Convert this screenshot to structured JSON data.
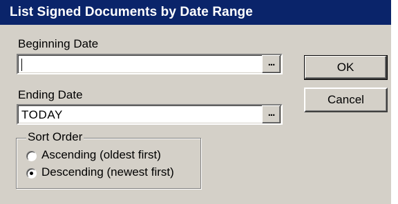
{
  "window": {
    "title": "List Signed Documents by Date Range"
  },
  "beginning": {
    "label": "Beginning Date",
    "value": "",
    "button_label": "..."
  },
  "ending": {
    "label": "Ending Date",
    "value": "TODAY",
    "button_label": "..."
  },
  "buttons": {
    "ok": "OK",
    "cancel": "Cancel"
  },
  "sort_order": {
    "legend": "Sort Order",
    "options": [
      {
        "label": "Ascending (oldest first)",
        "selected": false
      },
      {
        "label": "Descending (newest first)",
        "selected": true
      }
    ]
  },
  "colors": {
    "titlebar": "#0a246a",
    "dialog_bg": "#d4d0c8"
  }
}
